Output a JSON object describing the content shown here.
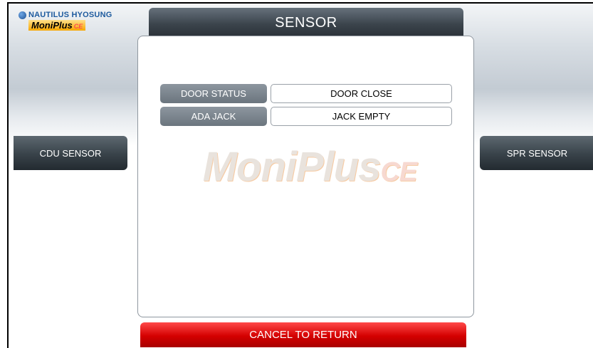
{
  "brand": {
    "company": "NAUTILUS HYOSUNG",
    "product": "MoniPlus",
    "product_suffix": "CE"
  },
  "title": "SENSOR",
  "rows": [
    {
      "label": "DOOR STATUS",
      "value": "DOOR CLOSE"
    },
    {
      "label": "ADA JACK",
      "value": "JACK EMPTY"
    }
  ],
  "watermark": {
    "text": "MoniPlus",
    "suffix": "CE"
  },
  "buttons": {
    "left": "CDU SENSOR",
    "right": "SPR SENSOR",
    "cancel": "CANCEL TO RETURN"
  },
  "colors": {
    "title_bar": "#3b444c",
    "label_cell": "#7b858e",
    "cancel": "#d40000",
    "brand_blue": "#1d5a9e"
  }
}
